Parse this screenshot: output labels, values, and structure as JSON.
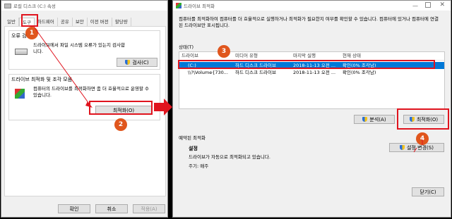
{
  "left_window": {
    "title": "로컬 디스크 (C:) 속성",
    "tabs": [
      "일반",
      "도구",
      "하드웨어",
      "공유",
      "보안",
      "이전 버전",
      "할당량"
    ],
    "error_check": {
      "group_title": "오류 검사",
      "description": "드라이브에서 파일 시스템 오류가 있는지 검사합니다.",
      "button": "검사(C)"
    },
    "optimize": {
      "group_title": "드라이브 최적화 및 조각 모음",
      "description": "컴퓨터의 드라이브를 최적화하면 좀 더 효율적으로 운영할 수 있습니다.",
      "button": "최적화(O)"
    },
    "footer": {
      "ok": "확인",
      "cancel": "취소",
      "apply": "적용(A)"
    }
  },
  "right_window": {
    "title": "드라이브 최적화",
    "description": "컴퓨터를 최적화하여 컴퓨터를 더 효율적으로 실행하거나 최적화가 필요한지 여부를 확인할 수 있습니다. 컴퓨터에 있거나 컴퓨터에 연결된 드라이브만 표시됩니다.",
    "status_label": "상태(T)",
    "columns": [
      "드라이브",
      "미디어 유형",
      "마지막 실행",
      "현재 상태"
    ],
    "rows": [
      {
        "drive": "(C:)",
        "media": "하드 디스크 드라이브",
        "last_run": "2018-11-13 오전 ...",
        "status": "확인(0% 조각남)"
      },
      {
        "drive": "\\\\?\\Volume{730...",
        "media": "하드 디스크 드라이브",
        "last_run": "2018-11-13 오전 ...",
        "status": "확인(0% 조각남)"
      }
    ],
    "analyze_button": "분석(A)",
    "optimize_button": "최적화(O)",
    "scheduled": {
      "section_title": "예약된 최적화",
      "state_label": "설정",
      "state_text": "드라이브가 자동으로 최적화되고 있습니다.",
      "frequency": "주기: 매주",
      "change_button": "설정 변경(S)"
    },
    "close_button": "닫기(C)"
  },
  "badges": [
    "1",
    "2",
    "3",
    "4"
  ],
  "colors": {
    "highlight": "#e0141e",
    "badge": "#e0561d",
    "selection": "#0078d7"
  }
}
